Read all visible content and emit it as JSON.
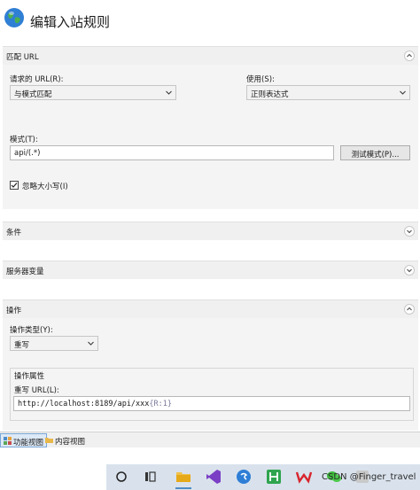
{
  "header": {
    "title": "编辑入站规则"
  },
  "match_url": {
    "title": "匹配 URL",
    "requested_url_label": "请求的 URL(R):",
    "requested_url_value": "与模式匹配",
    "using_label": "使用(S):",
    "using_value": "正则表达式",
    "pattern_label": "模式(T):",
    "pattern_value": "api/(.*)",
    "test_button": "测试模式(P)...",
    "ignore_case_label": "忽略大小写(I)",
    "ignore_case_checked": true
  },
  "conditions": {
    "title": "条件"
  },
  "server_variables": {
    "title": "服务器变量"
  },
  "action": {
    "title": "操作",
    "type_label": "操作类型(Y):",
    "type_value": "重写",
    "properties_legend": "操作属性",
    "rewrite_url_label": "重写 URL(L):",
    "rewrite_url_value": "http://localhost:8189/api/xxx",
    "rewrite_url_suffix": "{R:1}"
  },
  "tabs": [
    {
      "label": "功能视图",
      "active": true
    },
    {
      "label": "内容视图",
      "active": false
    }
  ],
  "watermark": "CSDN @Finger_travel",
  "colors": {
    "accent": "#4e8cc8",
    "taskbar": "#d9e2ec"
  }
}
